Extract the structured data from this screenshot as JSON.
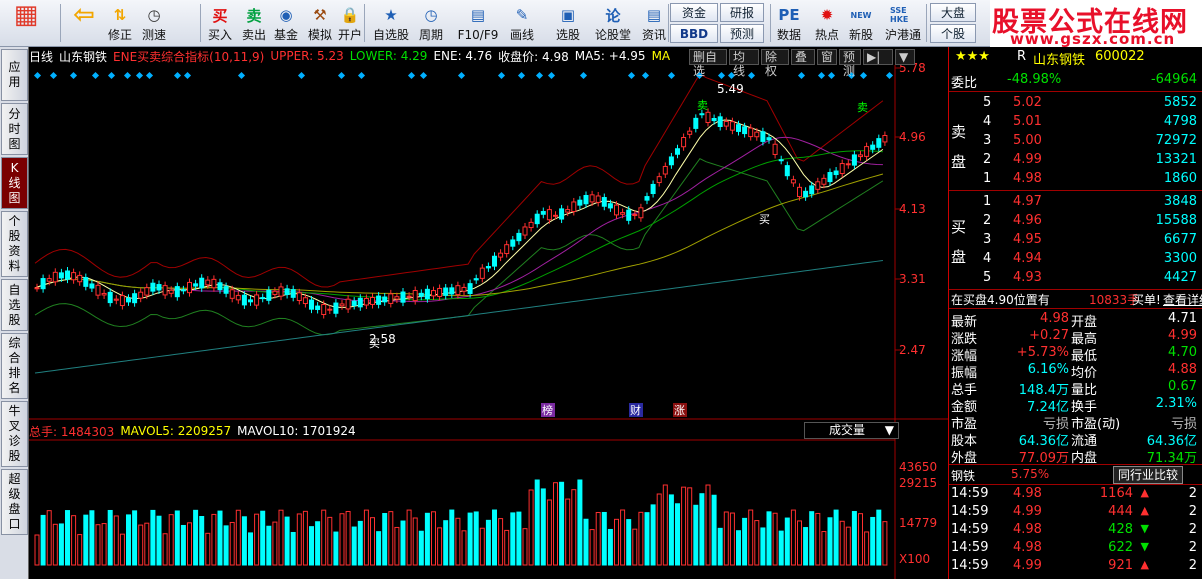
{
  "toolbar": {
    "buttons": [
      {
        "label": "",
        "icon": "app-grid-icon",
        "color": "#e03a2a"
      },
      {
        "label": "",
        "icon": "back-arrow-icon",
        "color": "#f2a600"
      },
      {
        "label": "修正",
        "icon": "up-down-arrow-icon",
        "color": "#f2a600"
      },
      {
        "label": "测速",
        "icon": "clock-icon",
        "color": "#333333"
      },
      {
        "label": "买入",
        "icon": "buy-icon",
        "text": "买",
        "color": "#e01010"
      },
      {
        "label": "卖出",
        "icon": "sell-icon",
        "text": "卖",
        "color": "#00a040"
      },
      {
        "label": "基金",
        "icon": "fund-icon",
        "color": "#1f5fb5"
      },
      {
        "label": "模拟",
        "icon": "hammer-icon",
        "color": "#9a4a10"
      },
      {
        "label": "开户",
        "icon": "lock-icon",
        "color": "#777777"
      },
      {
        "label": "自选股",
        "icon": "star-list-icon",
        "color": "#1f5fb5"
      },
      {
        "label": "周期",
        "icon": "period-clock-icon",
        "color": "#1f5fb5"
      },
      {
        "label": "F10/F9",
        "icon": "f10-icon",
        "color": "#1f5fb5"
      },
      {
        "label": "画线",
        "icon": "pencil-icon",
        "color": "#1f5fb5"
      },
      {
        "label": "选股",
        "icon": "chart-select-icon",
        "color": "#1f5fb5"
      },
      {
        "label": "论股堂",
        "icon": "discuss-icon",
        "text": "论",
        "color": "#1f5fb5"
      },
      {
        "label": "资讯",
        "icon": "news-icon",
        "color": "#1f5fb5"
      },
      {
        "label": "数据",
        "icon": "pe-data-icon",
        "text": "PE",
        "color": "#1f5fb5"
      },
      {
        "label": "热点",
        "icon": "hot-icon",
        "color": "#e01010"
      },
      {
        "label": "新股",
        "icon": "ipo-icon",
        "text": "NEW",
        "color": "#1f5fb5"
      },
      {
        "label": "沪港通",
        "icon": "sse-hkex-icon",
        "text": "SSE HKE",
        "color": "#1f5fb5"
      }
    ],
    "small": {
      "capital": "资金",
      "bbd": "BBD",
      "research": "研报",
      "forecast": "预测",
      "market": "大盘",
      "stock": "个股"
    }
  },
  "brand": {
    "title": "股票公式在线网",
    "url": "www.gszx.com.cn"
  },
  "side_tabs": [
    "应用",
    "分时图",
    "K线图",
    "个股资料",
    "自选股",
    "综合排名",
    "牛叉诊股",
    "超级盘口"
  ],
  "chart": {
    "header": {
      "period": "日线",
      "name": "山东钢铁",
      "indicator": "ENE买卖综合指标(10,11,9)",
      "upper": "UPPER: 5.23",
      "lower": "LOWER: 4.29",
      "ene": "ENE: 4.76",
      "close": "收盘价: 4.98",
      "ma5": "MA5: +4.95",
      "ma": "MA"
    },
    "buttons": [
      "删自选",
      "均线",
      "除权",
      "叠",
      "窗",
      "预测",
      "▶|",
      "▼"
    ],
    "price_axis": [
      "5.78",
      "4.96",
      "4.13",
      "3.31",
      "2.47"
    ],
    "high_label": "5.49",
    "low_label": "2.58",
    "buy_signal": "买",
    "sell_signal": "卖",
    "events": [
      {
        "text": "榜",
        "color": "#7a2aa0"
      },
      {
        "text": "财",
        "color": "#2a2aa0"
      },
      {
        "text": "涨",
        "color": "#8a1010"
      }
    ],
    "volume": {
      "total": "总手: 1484303",
      "mavol5": "MAVOL5: 2209257",
      "mavol10": "MAVOL10: 1701924",
      "selector": "成交量",
      "axis": [
        "43650",
        "29215",
        "14779",
        "X100"
      ]
    }
  },
  "quote": {
    "header": {
      "stars": "★★★",
      "flag": "R",
      "name": "山东钢铁",
      "code": "600022"
    },
    "weibi": {
      "label": "委比",
      "pct": "-48.98%",
      "diff": "-64964"
    },
    "sell_label": [
      "卖",
      "盘"
    ],
    "buy_label": [
      "买",
      "盘"
    ],
    "asks": [
      {
        "lvl": "5",
        "price": "5.02",
        "vol": "5852"
      },
      {
        "lvl": "4",
        "price": "5.01",
        "vol": "4798"
      },
      {
        "lvl": "3",
        "price": "5.00",
        "vol": "72972"
      },
      {
        "lvl": "2",
        "price": "4.99",
        "vol": "13321"
      },
      {
        "lvl": "1",
        "price": "4.98",
        "vol": "1860"
      }
    ],
    "bids": [
      {
        "lvl": "1",
        "price": "4.97",
        "vol": "3848"
      },
      {
        "lvl": "2",
        "price": "4.96",
        "vol": "15588"
      },
      {
        "lvl": "3",
        "price": "4.95",
        "vol": "6677"
      },
      {
        "lvl": "4",
        "price": "4.94",
        "vol": "3300"
      },
      {
        "lvl": "5",
        "price": "4.93",
        "vol": "4427"
      }
    ],
    "notice": {
      "text": "在买盘4.90位置有",
      "amount": "10833手",
      "tail": "买单!",
      "link": "查看详细"
    },
    "stats": [
      {
        "l1": "最新",
        "v1": "4.98",
        "c1": "r",
        "l2": "开盘",
        "v2": "4.71",
        "c2": "w"
      },
      {
        "l1": "涨跌",
        "v1": "+0.27",
        "c1": "r",
        "l2": "最高",
        "v2": "4.99",
        "c2": "r"
      },
      {
        "l1": "涨幅",
        "v1": "+5.73%",
        "c1": "r",
        "l2": "最低",
        "v2": "4.70",
        "c2": "g"
      },
      {
        "l1": "振幅",
        "v1": "6.16%",
        "c1": "c",
        "l2": "均价",
        "v2": "4.88",
        "c2": "r"
      },
      {
        "l1": "总手",
        "v1": "148.4万",
        "c1": "c",
        "l2": "量比",
        "v2": "0.67",
        "c2": "g"
      },
      {
        "l1": "金额",
        "v1": "7.24亿",
        "c1": "c",
        "l2": "换手",
        "v2": "2.31%",
        "c2": "c"
      },
      {
        "l1": "市盈",
        "v1": "亏损",
        "c1": "gr",
        "l2": "市盈(动)",
        "v2": "亏损",
        "c2": "gr"
      },
      {
        "l1": "股本",
        "v1": "64.36亿",
        "c1": "c",
        "l2": "流通",
        "v2": "64.36亿",
        "c2": "c"
      },
      {
        "l1": "外盘",
        "v1": "77.09万",
        "c1": "r",
        "l2": "内盘",
        "v2": "71.34万",
        "c2": "g"
      }
    ],
    "industry": {
      "name": "钢铁",
      "pct": "5.75%",
      "button": "同行业比较"
    },
    "ticks": [
      {
        "time": "14:59",
        "price": "4.98",
        "vol": "1164",
        "dir": "up",
        "n": "2"
      },
      {
        "time": "14:59",
        "price": "4.99",
        "vol": "444",
        "dir": "up",
        "n": "2"
      },
      {
        "time": "14:59",
        "price": "4.98",
        "vol": "428",
        "dir": "down",
        "n": "2"
      },
      {
        "time": "14:59",
        "price": "4.98",
        "vol": "622",
        "dir": "down",
        "n": "2"
      },
      {
        "time": "14:59",
        "price": "4.99",
        "vol": "921",
        "dir": "up",
        "n": "2"
      }
    ]
  }
}
